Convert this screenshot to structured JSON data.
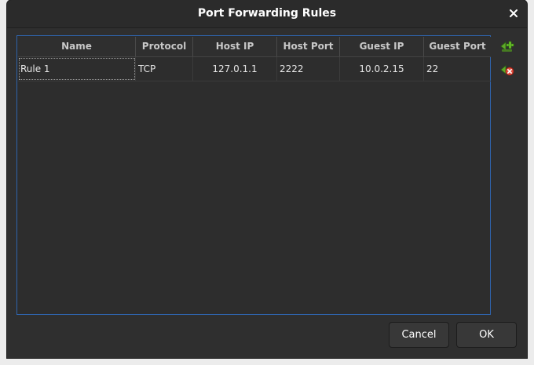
{
  "window": {
    "title": "Port Forwarding Rules",
    "close_icon": "close-icon"
  },
  "table": {
    "columns": [
      "Name",
      "Protocol",
      "Host IP",
      "Host Port",
      "Guest IP",
      "Guest Port"
    ],
    "rows": [
      [
        "Rule 1",
        "TCP",
        "127.0.1.1",
        "2222",
        "10.0.2.15",
        "22"
      ]
    ],
    "border_color": "#2f64ad"
  },
  "side_buttons": [
    {
      "name": "add-rule-button",
      "icon": "plus-icon"
    },
    {
      "name": "remove-rule-button",
      "icon": "remove-icon"
    }
  ],
  "footer": {
    "cancel_label": "Cancel",
    "ok_label": "OK"
  }
}
